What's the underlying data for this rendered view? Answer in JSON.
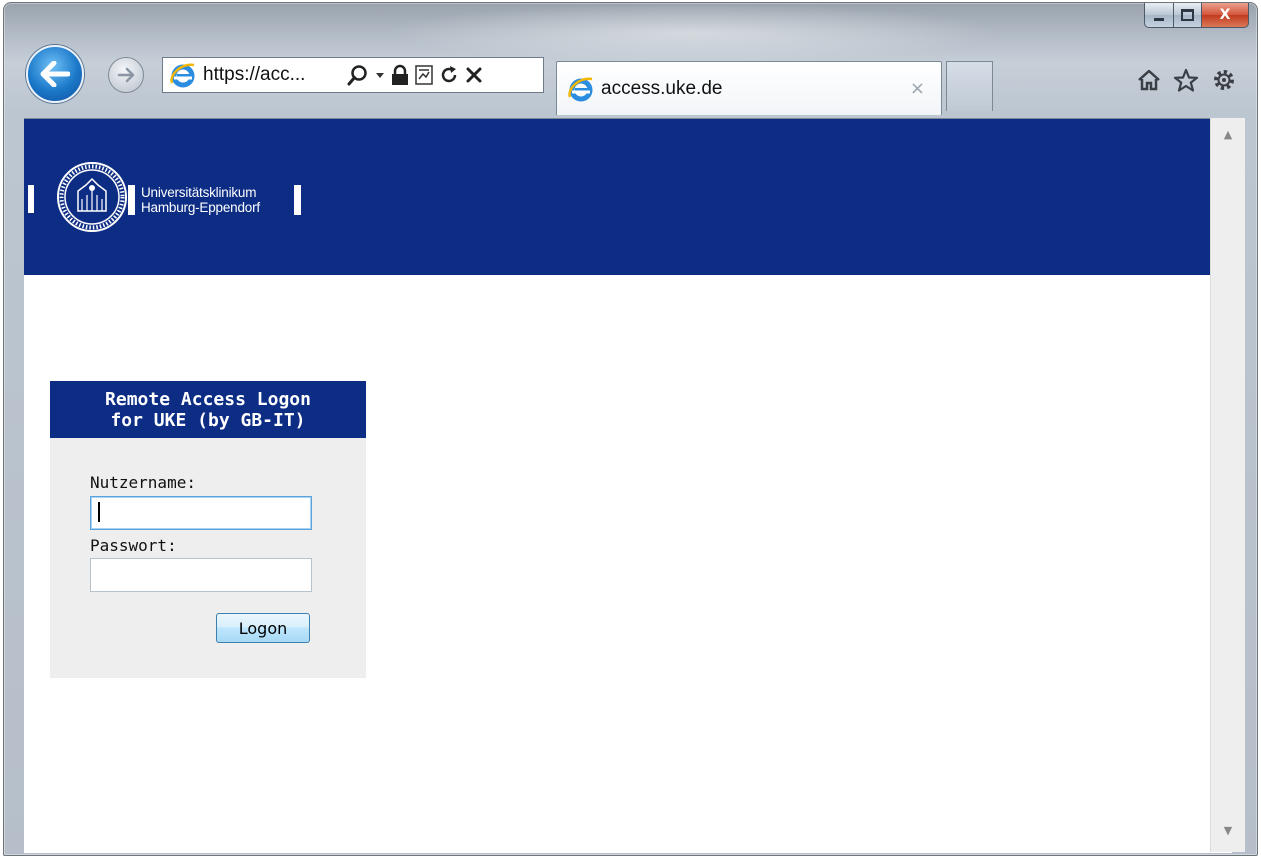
{
  "browser": {
    "address_url": "https://acc...",
    "tab_title": "access.uke.de",
    "tab_close": "×",
    "icons": [
      "back-icon",
      "forward-icon",
      "ie-logo-icon",
      "search-icon",
      "dropdown-icon",
      "lock-icon",
      "compat-view-icon",
      "refresh-icon",
      "stop-icon",
      "home-icon",
      "favorites-star-icon",
      "gear-icon"
    ]
  },
  "window": {
    "close_label": "X"
  },
  "page": {
    "org_line1": "Universitätsklinikum",
    "org_line2": "Hamburg-Eppendorf",
    "brand_color": "#0d2d85"
  },
  "logon": {
    "title_line1": "Remote Access Logon",
    "title_line2": "for UKE (by GB-IT)",
    "username_label": "Nutzername:",
    "username_value": "",
    "password_label": "Passwort:",
    "password_value": "",
    "submit_label": "Logon"
  }
}
